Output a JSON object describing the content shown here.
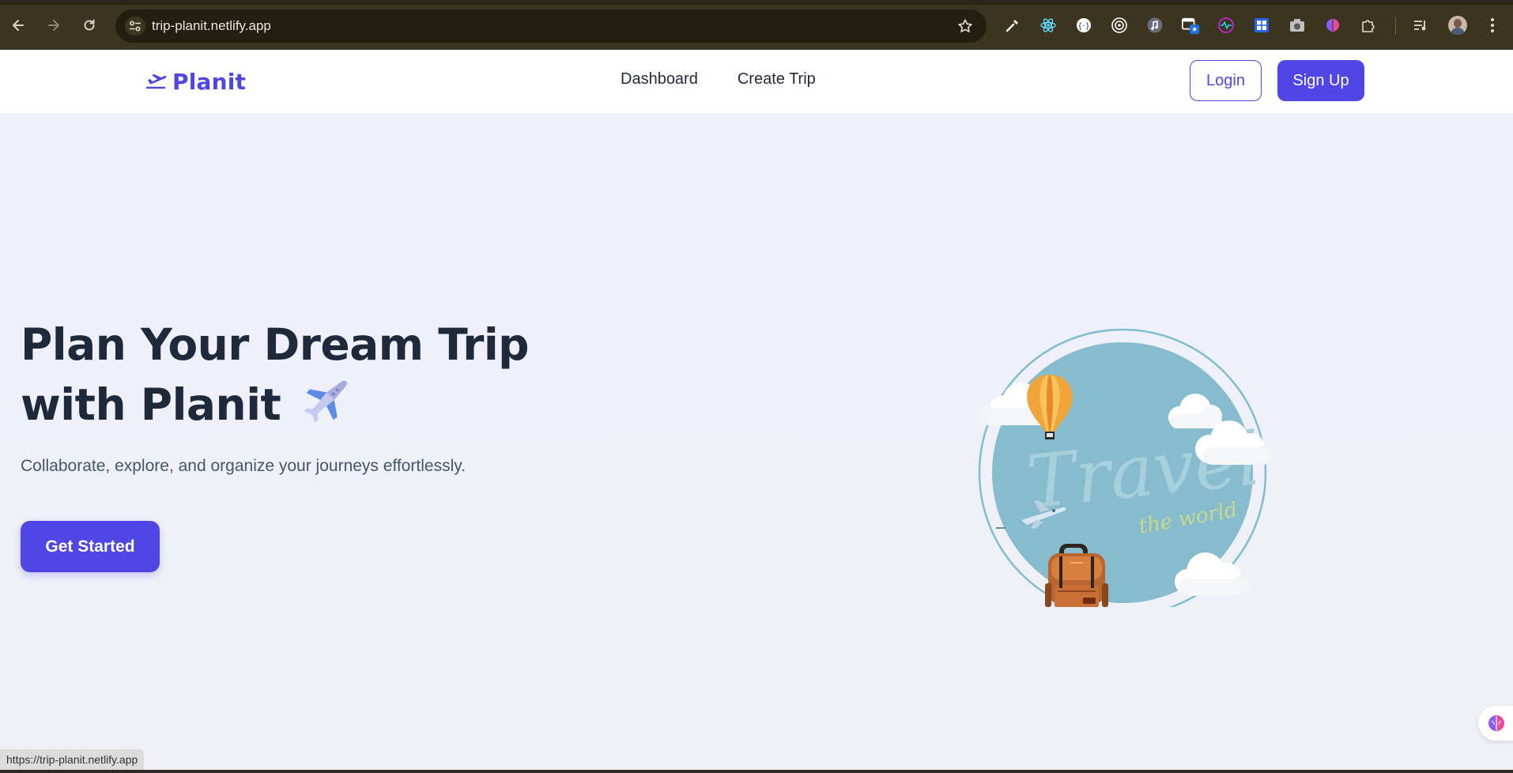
{
  "browser": {
    "url": "trip-planit.netlify.app",
    "status_url": "https://trip-planit.netlify.app",
    "icons": {
      "back": "back-arrow-icon",
      "forward": "forward-arrow-icon",
      "reload": "reload-icon",
      "site_settings": "tune-icon",
      "bookmark": "star-icon",
      "menu": "kebab-menu-icon"
    },
    "extensions": [
      "eyedropper-icon",
      "react-devtools-icon",
      "ext-circle-icon",
      "target-icon",
      "music-icon",
      "window-badge-icon",
      "pulse-icon",
      "shield-grid-icon",
      "camera-icon",
      "brain-icon",
      "puzzle-icon"
    ]
  },
  "header": {
    "brand": "Planit",
    "nav": [
      {
        "label": "Dashboard"
      },
      {
        "label": "Create Trip"
      }
    ],
    "login_label": "Login",
    "signup_label": "Sign Up"
  },
  "hero": {
    "title_line1": "Plan Your Dream Trip",
    "title_line2": "with Planit",
    "subtitle": "Collaborate, explore, and organize your journeys effortlessly.",
    "cta_label": "Get Started"
  },
  "illustration": {
    "script_text": "Travel",
    "sub_text": "the world"
  },
  "colors": {
    "primary": "#4f46e5",
    "heading": "#1e293b",
    "body_text": "#475569",
    "chrome_bg": "#3b3520",
    "globe": "#87bccf"
  }
}
